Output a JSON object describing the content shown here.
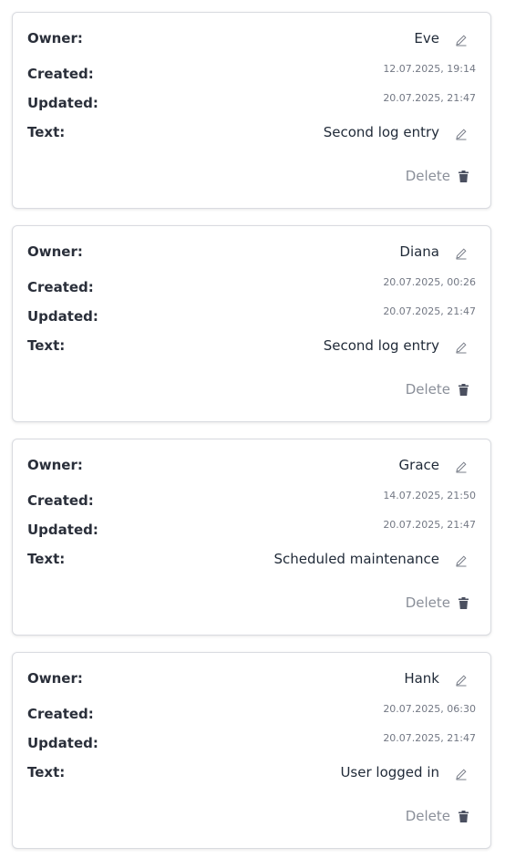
{
  "labels": {
    "owner": "Owner:",
    "created": "Created:",
    "updated": "Updated:",
    "text": "Text:",
    "delete": "Delete"
  },
  "icons": {
    "edit": "pencil-icon",
    "delete": "trash-icon"
  },
  "colors": {
    "label": "#2a2f3a",
    "date": "#737884",
    "delete": "#8a8f99",
    "trash": "#4b5060",
    "border": "#d9dbe0"
  },
  "entries": [
    {
      "owner": "Eve",
      "created": "12.07.2025, 19:14",
      "updated": "20.07.2025, 21:47",
      "text": "Second log entry"
    },
    {
      "owner": "Diana",
      "created": "20.07.2025, 00:26",
      "updated": "20.07.2025, 21:47",
      "text": "Second log entry"
    },
    {
      "owner": "Grace",
      "created": "14.07.2025, 21:50",
      "updated": "20.07.2025, 21:47",
      "text": "Scheduled maintenance"
    },
    {
      "owner": "Hank",
      "created": "20.07.2025, 06:30",
      "updated": "20.07.2025, 21:47",
      "text": "User logged in"
    }
  ]
}
